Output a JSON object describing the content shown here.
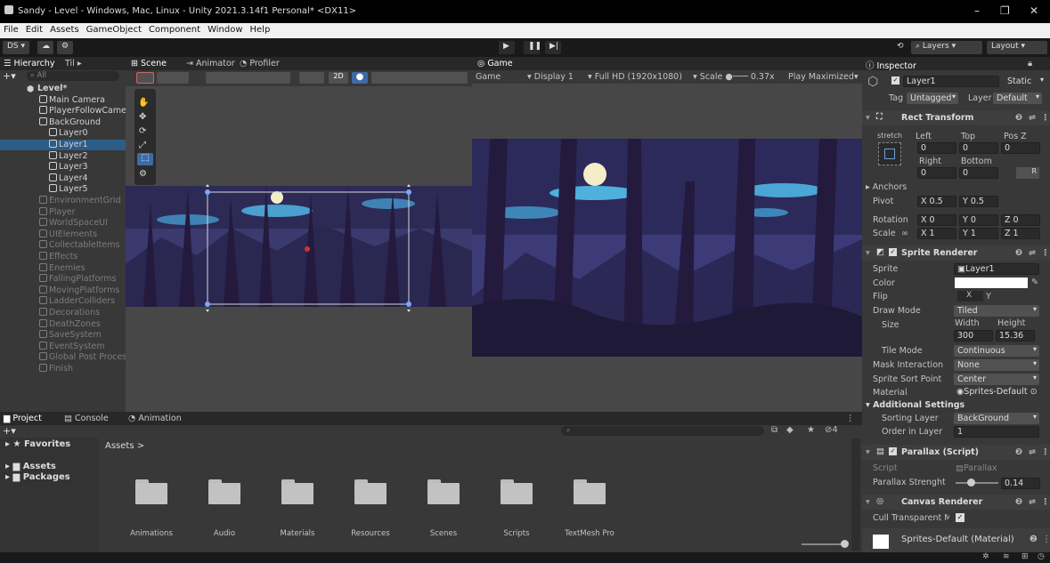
{
  "window": {
    "title": "Sandy - Level - Windows, Mac, Linux - Unity 2021.3.14f1 Personal* <DX11>",
    "min": "–",
    "max": "❐",
    "close": "✕"
  },
  "menu": [
    "File",
    "Edit",
    "Assets",
    "GameObject",
    "Component",
    "Window",
    "Help"
  ],
  "toolbar": {
    "account": "DS ▾",
    "layers": "Layers",
    "layout": "Layout"
  },
  "hierarchy": {
    "tab": "Hierarchy",
    "tab2": "Til",
    "search": "All",
    "rows": [
      {
        "label": "Level*",
        "indent": 0,
        "bold": true,
        "dim": false
      },
      {
        "label": "Main Camera",
        "indent": 1,
        "dim": false
      },
      {
        "label": "PlayerFollowCamera",
        "indent": 1,
        "dim": false
      },
      {
        "label": "BackGround",
        "indent": 1,
        "dim": false
      },
      {
        "label": "Layer0",
        "indent": 2,
        "dim": false
      },
      {
        "label": "Layer1",
        "indent": 2,
        "dim": false,
        "selected": true
      },
      {
        "label": "Layer2",
        "indent": 2,
        "dim": false
      },
      {
        "label": "Layer3",
        "indent": 2,
        "dim": false
      },
      {
        "label": "Layer4",
        "indent": 2,
        "dim": false
      },
      {
        "label": "Layer5",
        "indent": 2,
        "dim": false
      },
      {
        "label": "EnvironmentGrid",
        "indent": 1,
        "dim": true
      },
      {
        "label": "Player",
        "indent": 1,
        "dim": true
      },
      {
        "label": "WorldSpaceUI",
        "indent": 1,
        "dim": true
      },
      {
        "label": "UIElements",
        "indent": 1,
        "dim": true
      },
      {
        "label": "CollectableItems",
        "indent": 1,
        "dim": true
      },
      {
        "label": "Effects",
        "indent": 1,
        "dim": true
      },
      {
        "label": "Enemies",
        "indent": 1,
        "dim": true
      },
      {
        "label": "FallingPlatforms",
        "indent": 1,
        "dim": true
      },
      {
        "label": "MovingPlatforms",
        "indent": 1,
        "dim": true
      },
      {
        "label": "LadderColliders",
        "indent": 1,
        "dim": true
      },
      {
        "label": "Decorations",
        "indent": 1,
        "dim": true
      },
      {
        "label": "DeathZones",
        "indent": 1,
        "dim": true
      },
      {
        "label": "SaveSystem",
        "indent": 1,
        "dim": true
      },
      {
        "label": "EventSystem",
        "indent": 1,
        "dim": true
      },
      {
        "label": "Global Post Process",
        "indent": 1,
        "dim": true
      },
      {
        "label": "Finish",
        "indent": 1,
        "dim": true
      }
    ]
  },
  "scene": {
    "tabs": [
      "Scene",
      "Animator",
      "Profiler"
    ],
    "mode2d": "2D"
  },
  "game": {
    "tab": "Game",
    "label": "Game",
    "display": "Display 1",
    "resolution": "Full HD (1920x1080)",
    "scale_label": "Scale",
    "scale": "0.37x",
    "play": "Play Maximized"
  },
  "inspector": {
    "tab": "Inspector",
    "object_name": "Layer1",
    "static": "Static",
    "tag_label": "Tag",
    "tag": "Untagged",
    "layer_label": "Layer",
    "layer": "Default",
    "rect_transform": {
      "title": "Rect Transform",
      "stretch": "stretch",
      "cols1": [
        "Left",
        "Top",
        "Pos Z"
      ],
      "vals1": [
        "0",
        "0",
        "0"
      ],
      "cols2": [
        "Right",
        "Bottom"
      ],
      "vals2": [
        "0",
        "0"
      ],
      "anchors": "Anchors",
      "pivot_label": "Pivot",
      "pivot_x": "0.5",
      "pivot_y": "0.5",
      "rotation_label": "Rotation",
      "rot": [
        "0",
        "0",
        "0"
      ],
      "scale_label": "Scale",
      "scale": [
        "1",
        "1",
        "1"
      ],
      "r_btn": "R"
    },
    "sprite_renderer": {
      "title": "Sprite Renderer",
      "sprite_label": "Sprite",
      "sprite": "Layer1",
      "color_label": "Color",
      "flip_label": "Flip",
      "flip_x": "X",
      "flip_y": "Y",
      "draw_mode_label": "Draw Mode",
      "draw_mode": "Tiled",
      "size_label": "Size",
      "width_label": "Width",
      "height_label": "Height",
      "width": "300",
      "height": "15.36",
      "tile_mode_label": "Tile Mode",
      "tile_mode": "Continuous",
      "mask_label": "Mask Interaction",
      "mask": "None",
      "sort_point_label": "Sprite Sort Point",
      "sort_point": "Center",
      "material_label": "Material",
      "material": "Sprites-Default",
      "additional": "Additional Settings",
      "sorting_layer_label": "Sorting Layer",
      "sorting_layer": "BackGround",
      "order_label": "Order in Layer",
      "order": "1"
    },
    "parallax": {
      "title": "Parallax (Script)",
      "script_label": "Script",
      "script": "Parallax",
      "strength_label": "Parallax Strenght",
      "strength": "0.14",
      "strength_fraction": 0.14
    },
    "canvas_renderer": {
      "title": "Canvas Renderer",
      "cull_label": "Cull Transparent Me"
    },
    "material_footer": "Sprites-Default (Material)"
  },
  "project": {
    "tabs": [
      "Project",
      "Console",
      "Animation"
    ],
    "favorites": "Favorites",
    "tree": [
      "Assets",
      "Packages"
    ],
    "breadcrumb": "Assets >",
    "count": "4",
    "folders": [
      "Animations",
      "Audio",
      "Materials",
      "Resources",
      "Scenes",
      "Scripts",
      "TextMesh Pro"
    ]
  }
}
